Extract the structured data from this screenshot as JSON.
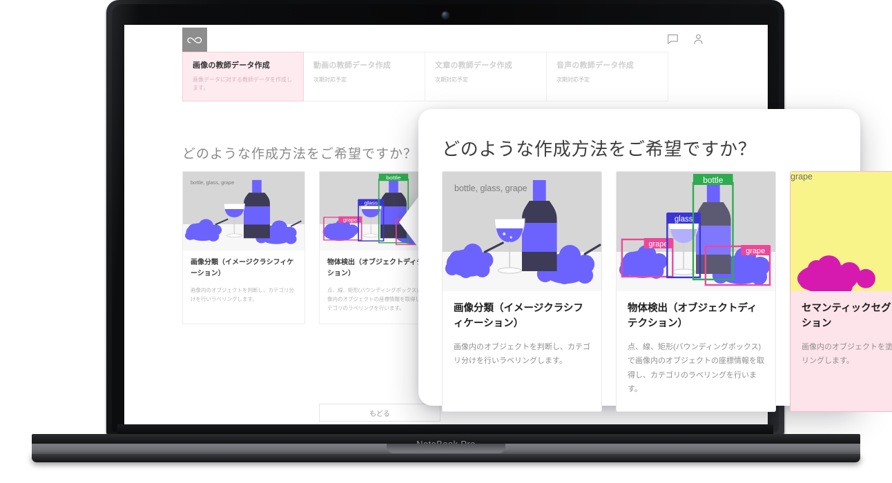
{
  "device": {
    "brand_label": "NoteBook Pro",
    "webcam": "camera-dot"
  },
  "app": {
    "logo": "infinity-logo-icon",
    "header_icons": [
      {
        "name": "chat-icon",
        "label": "chat"
      },
      {
        "name": "account-icon",
        "label": "account"
      }
    ],
    "tabs": [
      {
        "title": "画像の教師データ作成",
        "subtitle": "画像データに対する教師データを作成します。",
        "active": true
      },
      {
        "title": "動画の教師データ作成",
        "subtitle": "次期対応予定",
        "active": false
      },
      {
        "title": "文章の教師データ作成",
        "subtitle": "次期対応予定",
        "active": false
      },
      {
        "title": "音声の教師データ作成",
        "subtitle": "次期対応予定",
        "active": false
      }
    ]
  },
  "page": {
    "heading": "どのような作成方法をご希望ですか？",
    "back_button": "もどる",
    "cards": [
      {
        "title": "画像分類（イメージクラシフィケーション）",
        "desc": "画像内のオブジェクトを判断し、カテゴリ分けを行いラベリングします。",
        "thumb": "wine-still-life-classification",
        "caption": "bottle, glass, grape"
      },
      {
        "title": "物体検出（オブジェクトディテクション）",
        "desc": "点、線、矩形(バウンディングボックス)で画像内のオブジェクトの座標情報を取得し、カテゴリのラベリングを行います。",
        "thumb": "wine-still-life-detection",
        "boxes": [
          {
            "label": "grape",
            "color": "#ec4899"
          },
          {
            "label": "glass",
            "color": "#3b35d6"
          },
          {
            "label": "bottle",
            "color": "#2eab4f"
          },
          {
            "label": "grape",
            "color": "#ec4899"
          }
        ]
      }
    ]
  },
  "overlay": {
    "heading": "どのような作成方法をご希望ですか？",
    "cards": [
      {
        "title": "画像分類（イメージクラシフィケーション）",
        "desc": "画像内のオブジェクトを判断し、カテゴリ分けを行いラベリングします。",
        "thumb": "wine-still-life-classification",
        "caption": "bottle, glass, grape",
        "highlight": false
      },
      {
        "title": "物体検出（オブジェクトディテクション）",
        "desc": "点、線、矩形(バウンディングボックス)で画像内のオブジェクトの座標情報を取得し、カテゴリのラベリングを行います。",
        "thumb": "wine-still-life-detection",
        "highlight": false,
        "boxes": [
          {
            "label": "grape",
            "color": "#ec4899"
          },
          {
            "label": "glass",
            "color": "#3b35d6"
          },
          {
            "label": "bottle",
            "color": "#2eab4f"
          },
          {
            "label": "grape",
            "color": "#ec4899"
          }
        ]
      },
      {
        "title": "セマンティックセグメンテーション",
        "desc": "画像内のオブジェクトを塗り分けてラベリングします。",
        "thumb": "grape-semantic-segmentation",
        "caption": "grape",
        "highlight": true
      }
    ]
  },
  "colors": {
    "accent_pink": "#fde3ea",
    "accent_pink_border": "#f6b8c8",
    "periwinkle": "#6c63ff",
    "bottle_dark": "#3d3b55",
    "thumb_bg": "#d6d6d6",
    "box_magenta": "#ec4899",
    "box_blue": "#3b35d6",
    "box_green": "#2eab4f",
    "seg_yellow": "#f9f48a",
    "seg_magenta": "#d61ab0"
  }
}
